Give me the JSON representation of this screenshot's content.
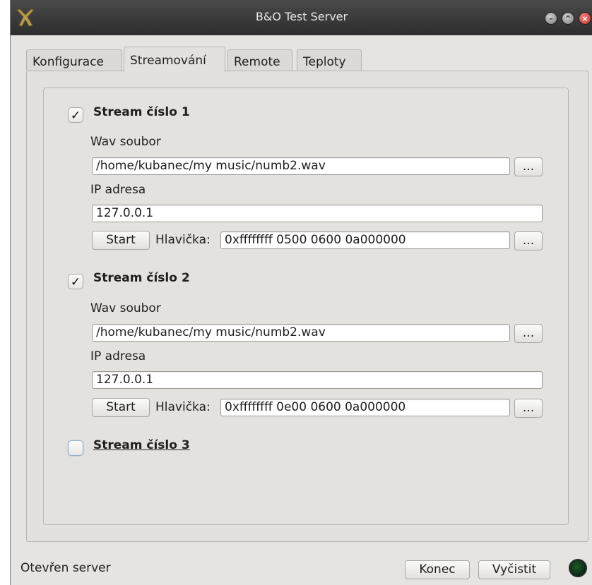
{
  "window": {
    "title": "B&O Test Server",
    "controls": [
      "minimize-icon",
      "maximize-icon",
      "close-icon"
    ]
  },
  "tabs": [
    {
      "label": "Konfigurace",
      "active": false
    },
    {
      "label": "Streamování",
      "active": true
    },
    {
      "label": "Remote",
      "active": false
    },
    {
      "label": "Teploty",
      "active": false
    }
  ],
  "streams": [
    {
      "title": "Stream číslo 1",
      "checked": true,
      "wav_label": "Wav soubor",
      "wav_value": "/home/kubanec/my music/numb2.wav",
      "browse_label": "...",
      "ip_label": "IP adresa",
      "ip_value": "127.0.0.1",
      "start_label": "Start",
      "header_label": "Hlavička:",
      "header_value": "0xffffffff 0500 0600 0a000000",
      "header_browse_label": "..."
    },
    {
      "title": "Stream číslo 2",
      "checked": true,
      "wav_label": "Wav soubor",
      "wav_value": "/home/kubanec/my music/numb2.wav",
      "browse_label": "...",
      "ip_label": "IP adresa",
      "ip_value": "127.0.0.1",
      "start_label": "Start",
      "header_label": "Hlavička:",
      "header_value": "0xffffffff 0e00 0600 0a000000",
      "header_browse_label": "..."
    },
    {
      "title": "Stream číslo 3",
      "checked": false
    }
  ],
  "checkmark": "✓",
  "status": {
    "text": "Otevřen server",
    "quit_label": "Konec",
    "clear_label": "Vyčistit",
    "led_color": "#1d5a2b"
  }
}
